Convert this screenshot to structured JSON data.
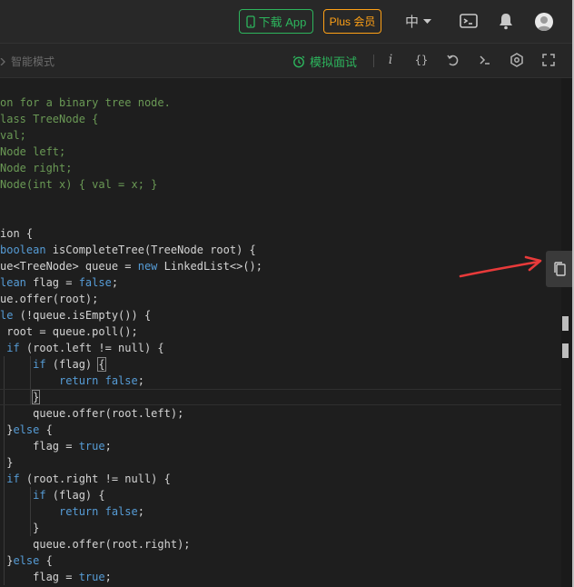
{
  "header": {
    "download_app_label": "下载 App",
    "plus_label": "Plus 会员",
    "language_label": "中",
    "icons": [
      "phone-icon",
      "language-caret-icon",
      "terminal-icon",
      "bell-icon",
      "avatar"
    ]
  },
  "toolbar": {
    "mode_label": "智能模式",
    "mock_interview_label": "模拟面试",
    "icons": [
      "info-icon",
      "format-braces-icon",
      "reset-icon",
      "console-icon",
      "settings-icon",
      "fullscreen-icon"
    ]
  },
  "colors": {
    "accent_green": "#2db55d",
    "plus_orange": "#ffa116",
    "comment": "#6a9955",
    "keyword": "#569cd6",
    "annotation_arrow": "#e83a3a"
  },
  "code_lines": [
    [
      {
        "t": "on for a binary tree node.",
        "c": "cmt"
      }
    ],
    [
      {
        "t": "lass TreeNode {",
        "c": "cmt"
      }
    ],
    [
      {
        "t": "val;",
        "c": "cmt"
      }
    ],
    [
      {
        "t": "Node left;",
        "c": "cmt"
      }
    ],
    [
      {
        "t": "Node right;",
        "c": "cmt"
      }
    ],
    [
      {
        "t": "Node(int x) { val = x; }",
        "c": "cmt"
      }
    ],
    [
      {
        "t": "",
        "c": ""
      }
    ],
    [
      {
        "t": "",
        "c": ""
      }
    ],
    [
      {
        "t": "ion {",
        "c": ""
      }
    ],
    [
      {
        "t": "boolean",
        "c": "kw"
      },
      {
        "t": " isCompleteTree(TreeNode root) {",
        "c": ""
      }
    ],
    [
      {
        "t": "ue<TreeNode> queue = ",
        "c": ""
      },
      {
        "t": "new",
        "c": "kw"
      },
      {
        "t": " LinkedList<>();",
        "c": ""
      }
    ],
    [
      {
        "t": "lean",
        "c": "kw"
      },
      {
        "t": " flag = ",
        "c": ""
      },
      {
        "t": "false",
        "c": "kw"
      },
      {
        "t": ";",
        "c": ""
      }
    ],
    [
      {
        "t": "ue.offer(root);",
        "c": ""
      }
    ],
    [
      {
        "t": "le",
        "c": "kw"
      },
      {
        "t": " (!queue.isEmpty()) {",
        "c": ""
      }
    ],
    [
      {
        "t": " root = queue.poll();",
        "c": ""
      }
    ],
    [
      {
        "t": " ",
        "c": ""
      },
      {
        "t": "if",
        "c": "kw"
      },
      {
        "t": " (root.left != null) {",
        "c": ""
      }
    ],
    [
      {
        "t": "     ",
        "c": ""
      },
      {
        "t": "if",
        "c": "kw"
      },
      {
        "t": " (flag) ",
        "c": ""
      },
      {
        "t": "{",
        "c": "bracket"
      }
    ],
    [
      {
        "t": "         ",
        "c": ""
      },
      {
        "t": "return false",
        "c": "kw"
      },
      {
        "t": ";",
        "c": ""
      }
    ],
    [
      {
        "t": "     ",
        "c": ""
      },
      {
        "t": "}",
        "c": "bracket"
      }
    ],
    [
      {
        "t": "     queue.offer(root.left);",
        "c": ""
      }
    ],
    [
      {
        "t": " }",
        "c": ""
      },
      {
        "t": "else",
        "c": "kw"
      },
      {
        "t": " {",
        "c": ""
      }
    ],
    [
      {
        "t": "     flag = ",
        "c": ""
      },
      {
        "t": "true",
        "c": "kw"
      },
      {
        "t": ";",
        "c": ""
      }
    ],
    [
      {
        "t": " }",
        "c": ""
      }
    ],
    [
      {
        "t": " ",
        "c": ""
      },
      {
        "t": "if",
        "c": "kw"
      },
      {
        "t": " (root.right != null) {",
        "c": ""
      }
    ],
    [
      {
        "t": "     ",
        "c": ""
      },
      {
        "t": "if",
        "c": "kw"
      },
      {
        "t": " (flag) {",
        "c": ""
      }
    ],
    [
      {
        "t": "         ",
        "c": ""
      },
      {
        "t": "return false",
        "c": "kw"
      },
      {
        "t": ";",
        "c": ""
      }
    ],
    [
      {
        "t": "     }",
        "c": ""
      }
    ],
    [
      {
        "t": "     queue.offer(root.right);",
        "c": ""
      }
    ],
    [
      {
        "t": " }",
        "c": ""
      },
      {
        "t": "else",
        "c": "kw"
      },
      {
        "t": " {",
        "c": ""
      }
    ],
    [
      {
        "t": "     flag = ",
        "c": ""
      },
      {
        "t": "true",
        "c": "kw"
      },
      {
        "t": ";",
        "c": ""
      }
    ]
  ],
  "copy_button_icon": "copy-icon"
}
